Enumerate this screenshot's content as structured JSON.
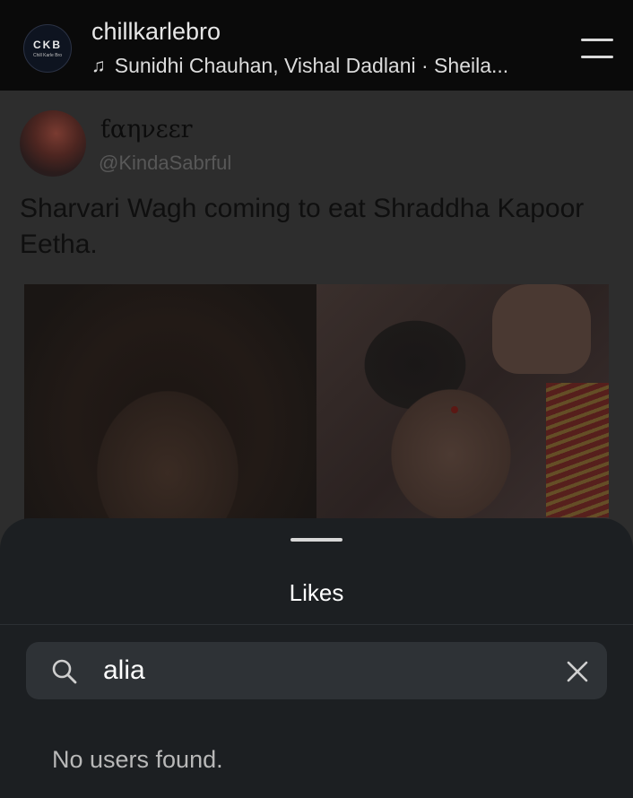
{
  "header": {
    "avatar_text": "CKB",
    "avatar_subtext": "Chill Karle Bro",
    "username": "chillkarlebro",
    "song_icon": "music-note-icon",
    "song": "Sunidhi Chauhan, Vishal Dadlani · Sheila...",
    "menu_icon": "menu-icon"
  },
  "post": {
    "author_name": "ƭαηνεεr",
    "author_handle": "@KindaSabrful",
    "text": "Sharvari Wagh coming to eat Shraddha Kapoor Eetha."
  },
  "likes_sheet": {
    "title": "Likes",
    "search_value": "alia",
    "search_icon": "search-icon",
    "clear_icon": "close-icon",
    "empty_message": "No users found."
  }
}
